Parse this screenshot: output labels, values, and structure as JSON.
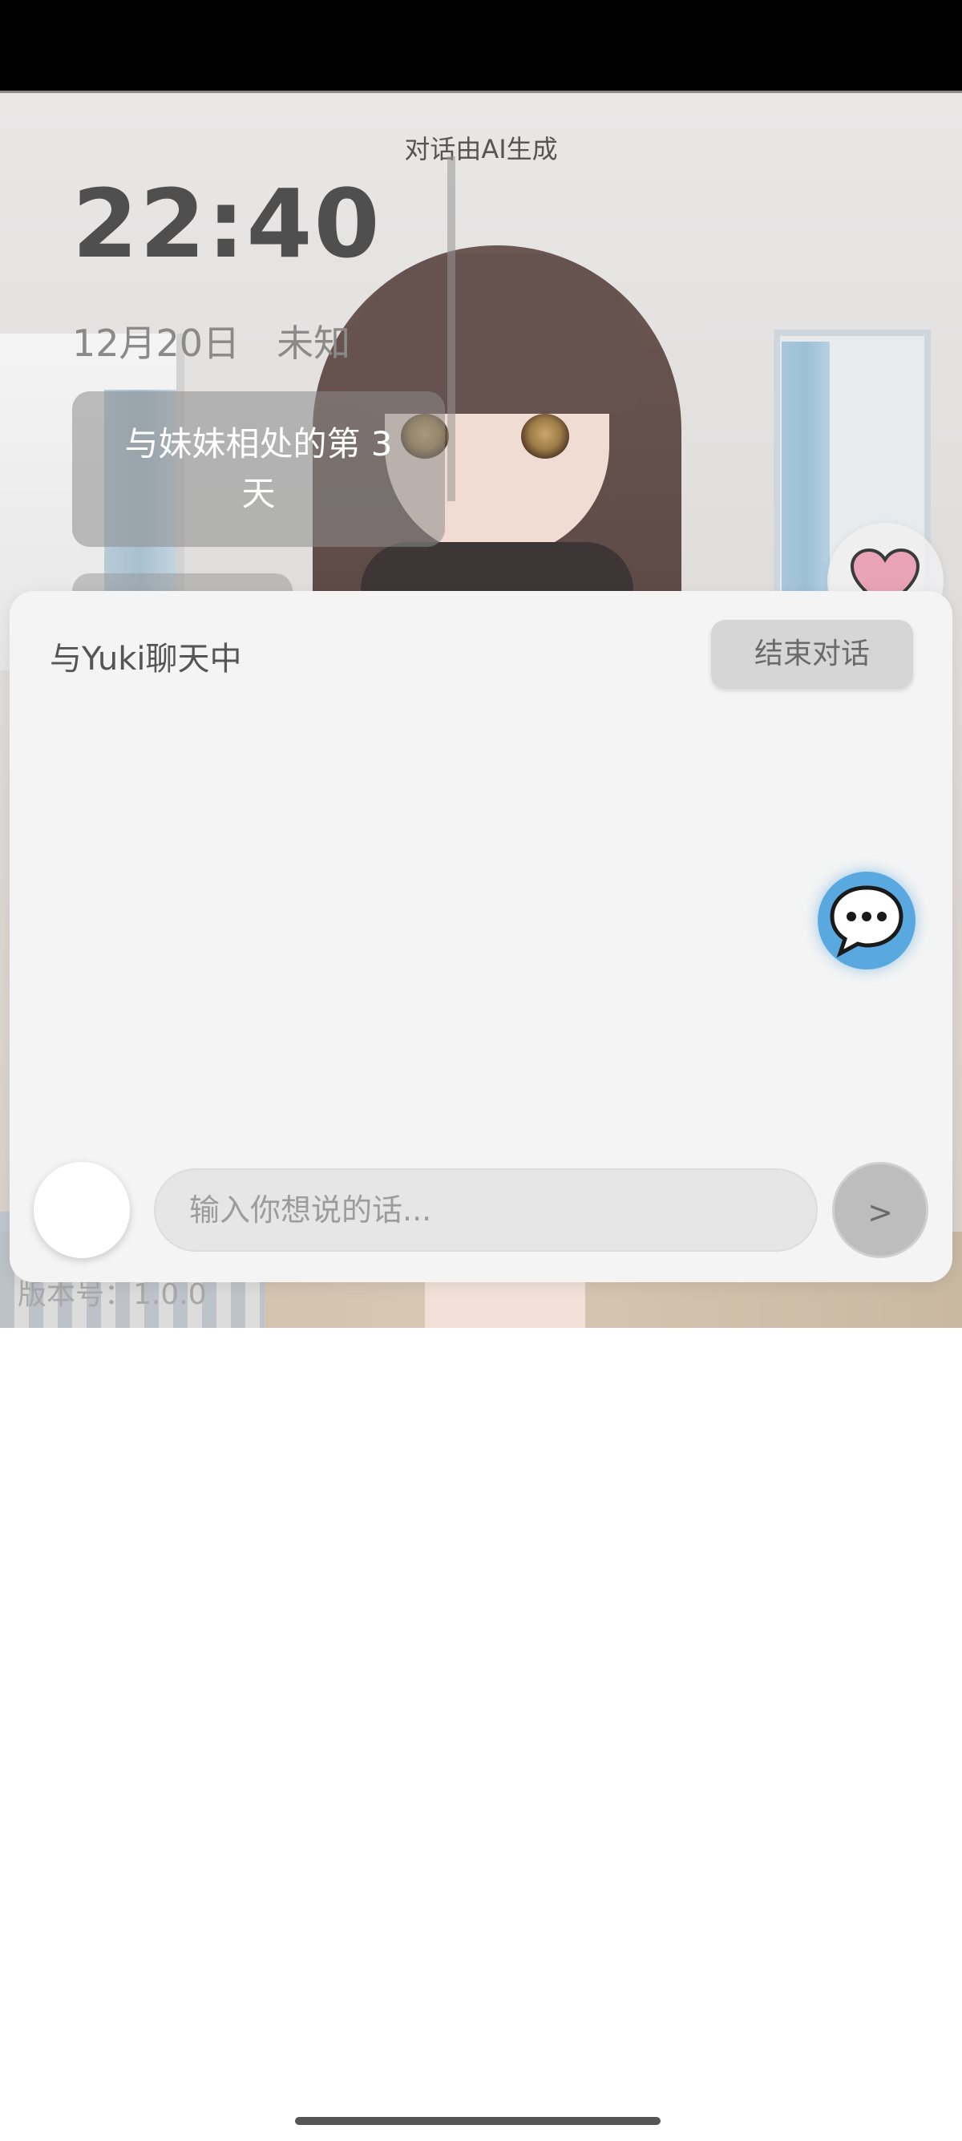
{
  "header": {
    "ai_notice": "对话由AI生成"
  },
  "clock": {
    "time": "22:40",
    "date": "12月20日　未知"
  },
  "day_counter": {
    "label": "与妹妹相处的第 3 天"
  },
  "chat": {
    "title": "与Yuki聊天中",
    "end_button_label": "结束对话",
    "input_placeholder": "输入你想说的话...",
    "send_label": ">"
  },
  "footer": {
    "version": "版本号：1.0.0"
  },
  "icons": {
    "heart": "heart-icon",
    "chat": "chat-bubble-icon"
  },
  "colors": {
    "chat_fab": "#5aa8e0",
    "heart": "#e8a3b6",
    "panel_bg": "#f4f4f4"
  }
}
